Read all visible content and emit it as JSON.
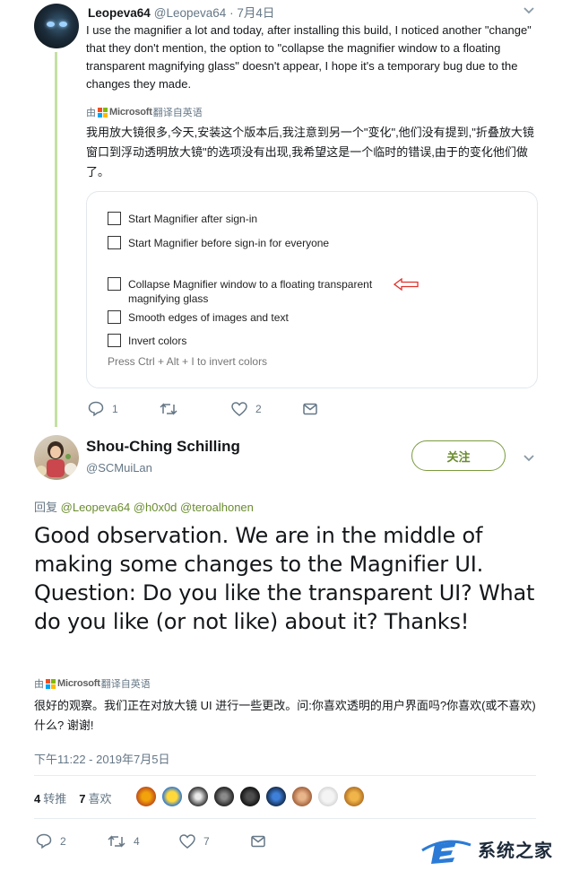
{
  "tweet1": {
    "display_name": "Leopeva64",
    "handle": "@Leopeva64 · 7月4日",
    "body": "I use the magnifier a lot and today, after installing this build, I noticed another \"change\" that they don't mention, the option to \"collapse the magnifier window to a floating transparent magnifying glass\" doesn't appear, I hope it's a temporary bug due to the changes they made.",
    "translate_prefix": "由",
    "translate_brand": "Microsoft",
    "translate_suffix": "翻译自英语",
    "translation": "我用放大镜很多,今天,安装这个版本后,我注意到另一个\"变化\",他们没有提到,\"折叠放大镜窗口到浮动透明放大镜\"的选项没有出现,我希望这是一个临时的错误,由于的变化他们做了。",
    "card": {
      "options": [
        "Start Magnifier after sign-in",
        "Start Magnifier before sign-in for everyone",
        "Collapse Magnifier window to a floating transparent magnifying glass",
        "Smooth edges of images and text",
        "Invert colors"
      ],
      "hint": "Press Ctrl + Alt + I to invert colors"
    },
    "actions": {
      "replies": "1",
      "retweets": "",
      "likes": "2"
    }
  },
  "tweet2": {
    "display_name": "Shou-Ching Schilling",
    "handle": "@SCMuiLan",
    "follow_label": "关注",
    "reply_prefix": "回复",
    "reply_mentions": "@Leopeva64 @h0x0d @teroalhonen",
    "body": "Good observation. We are in the middle of making some changes to the Magnifier UI. Question: Do you like the transparent UI? What do you like (or not like) about it? Thanks!",
    "translate_prefix": "由",
    "translate_brand": "Microsoft",
    "translate_suffix": "翻译自英语",
    "translation": "很好的观察。我们正在对放大镜 UI 进行一些更改。问:你喜欢透明的用户界面吗?你喜欢(或不喜欢)什么? 谢谢!",
    "timestamp": "下午11:22 - 2019年7月5日",
    "retweet_count": "4",
    "retweet_label": "转推",
    "like_count": "7",
    "like_label": "喜欢",
    "actions": {
      "replies": "2",
      "retweets": "4",
      "likes": "7"
    }
  },
  "watermark": {
    "text": "系统之家"
  },
  "colors": {
    "accent": "#6a8c2f",
    "thread": "#c4e1a4",
    "muted": "#657786"
  }
}
